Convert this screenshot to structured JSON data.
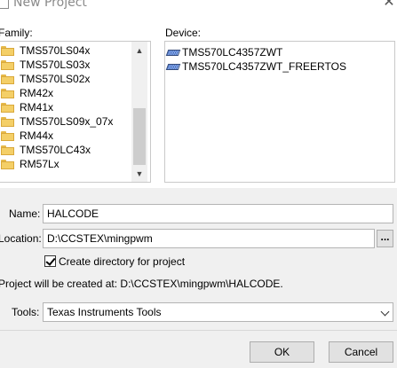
{
  "window": {
    "title": "New Project",
    "close_icon": "close-icon"
  },
  "family": {
    "label": "Family:",
    "items": [
      "TMS570LS04x",
      "TMS570LS03x",
      "TMS570LS02x",
      "RM42x",
      "RM41x",
      "TMS570LS09x_07x",
      "RM44x",
      "TMS570LC43x",
      "RM57Lx"
    ],
    "selected": "TMS570LC43x"
  },
  "device": {
    "label": "Device:",
    "items": [
      "TMS570LC4357ZWT",
      "TMS570LC4357ZWT_FREERTOS"
    ]
  },
  "name": {
    "label": "Name:",
    "value": "HALCODE"
  },
  "location": {
    "label": "Location:",
    "value": "D:\\CCSTEX\\mingpwm",
    "browse_label": "..."
  },
  "create_dir": {
    "label": "Create directory for project",
    "checked": true
  },
  "project_path_text": "Project will be created at: D:\\CCSTEX\\mingpwm\\HALCODE.",
  "tools": {
    "label": "Tools:",
    "value": "Texas Instruments Tools"
  },
  "buttons": {
    "ok": "OK",
    "cancel": "Cancel"
  }
}
